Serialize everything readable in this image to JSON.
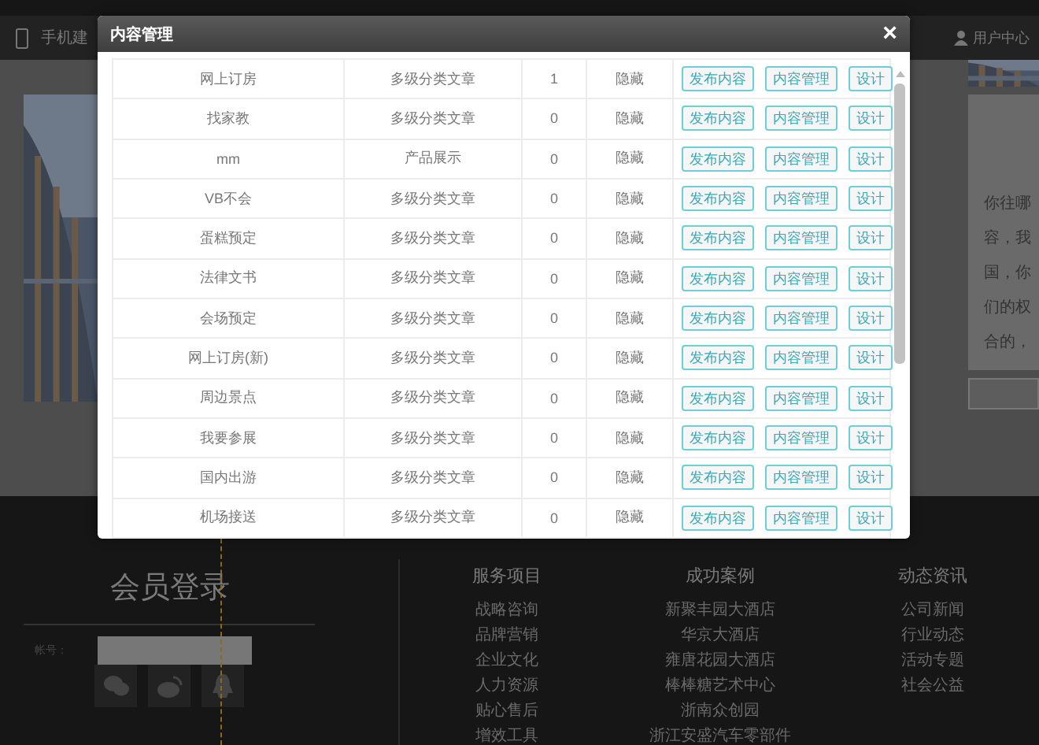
{
  "header": {
    "mobile_label": "手机建",
    "user_label": "用户中心"
  },
  "side_text": [
    "你往哪",
    "容，我",
    "国，你",
    "们的权",
    "合的，"
  ],
  "modal": {
    "title": "内容管理",
    "close": "×",
    "rows": [
      {
        "name": "网上订房",
        "type": "多级分类文章",
        "count": "1",
        "status": "隐藏",
        "actions": [
          "发布内容",
          "内容管理",
          "设计"
        ]
      },
      {
        "name": "找家教",
        "type": "多级分类文章",
        "count": "0",
        "status": "隐藏",
        "actions": [
          "发布内容",
          "内容管理",
          "设计"
        ]
      },
      {
        "name": "mm",
        "type": "产品展示",
        "count": "0",
        "status": "隐藏",
        "actions": [
          "发布内容",
          "内容管理",
          "设计"
        ]
      },
      {
        "name": "VB不会",
        "type": "多级分类文章",
        "count": "0",
        "status": "隐藏",
        "actions": [
          "发布内容",
          "内容管理",
          "设计"
        ]
      },
      {
        "name": "蛋糕预定",
        "type": "多级分类文章",
        "count": "0",
        "status": "隐藏",
        "actions": [
          "发布内容",
          "内容管理",
          "设计"
        ]
      },
      {
        "name": "法律文书",
        "type": "多级分类文章",
        "count": "0",
        "status": "隐藏",
        "actions": [
          "发布内容",
          "内容管理",
          "设计"
        ]
      },
      {
        "name": "会场预定",
        "type": "多级分类文章",
        "count": "0",
        "status": "隐藏",
        "actions": [
          "发布内容",
          "内容管理",
          "设计"
        ]
      },
      {
        "name": "网上订房(新)",
        "type": "多级分类文章",
        "count": "0",
        "status": "隐藏",
        "actions": [
          "发布内容",
          "内容管理",
          "设计"
        ]
      },
      {
        "name": "周边景点",
        "type": "多级分类文章",
        "count": "0",
        "status": "隐藏",
        "actions": [
          "发布内容",
          "内容管理",
          "设计"
        ]
      },
      {
        "name": "我要参展",
        "type": "多级分类文章",
        "count": "0",
        "status": "隐藏",
        "actions": [
          "发布内容",
          "内容管理",
          "设计"
        ]
      },
      {
        "name": "国内出游",
        "type": "多级分类文章",
        "count": "0",
        "status": "隐藏",
        "actions": [
          "发布内容",
          "内容管理",
          "设计"
        ]
      },
      {
        "name": "机场接送",
        "type": "多级分类文章",
        "count": "0",
        "status": "隐藏",
        "actions": [
          "发布内容",
          "内容管理",
          "设计"
        ]
      }
    ]
  },
  "login": {
    "title": "会员登录",
    "account_label": "帐号："
  },
  "footer_columns": [
    {
      "title": "服务项目",
      "links": [
        "战略咨询",
        "品牌营销",
        "企业文化",
        "人力资源",
        "贴心售后",
        "增效工具"
      ]
    },
    {
      "title": "成功案例",
      "links": [
        "新聚丰园大酒店",
        "华京大酒店",
        "雍唐花园大酒店",
        "棒棒糖艺术中心",
        "浙南众创园",
        "浙江安盛汽车零部件"
      ]
    },
    {
      "title": "动态资讯",
      "links": [
        "公司新闻",
        "行业动态",
        "活动专题",
        "社会公益"
      ]
    }
  ]
}
